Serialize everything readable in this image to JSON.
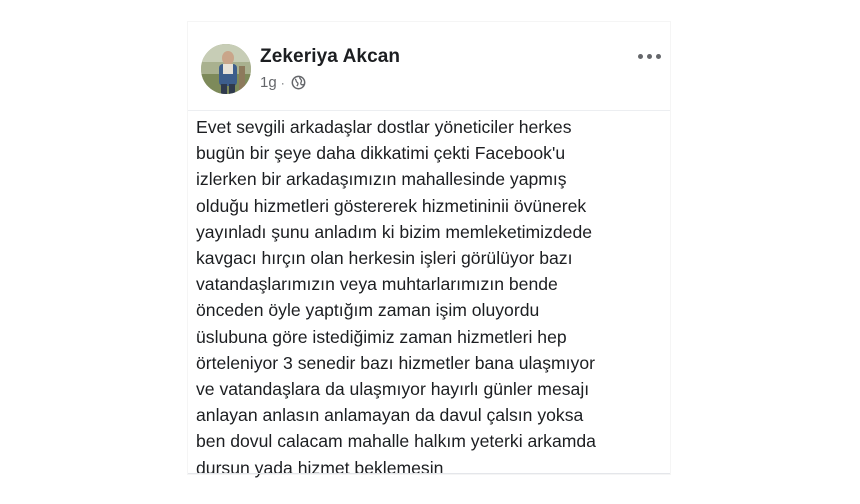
{
  "post": {
    "author": "Zekeriya Akcan",
    "time": "1g",
    "separator": "·",
    "privacy_icon": "globe-icon",
    "more_icon": "more-options-icon",
    "text": "Evet sevgili arkadaşlar dostlar yöneticiler herkes\nbugün bir şeye daha dikkatimi çekti Facebook'u\nizlerken bir arkadaşımızın mahallesinde yapmış\nolduğu hizmetleri göstererek hizmetininii övünerek\nyayınladı şunu anladım ki bizim memleketimizdede\nkavgacı hırçın olan herkesin işleri görülüyor bazı\nvatandaşlarımızın veya muhtarlarımızın bende\nönceden öyle yaptığım zaman işim oluyordu\nüslubuna göre istediğimiz zaman hizmetleri hep\nörteleniyor 3 senedir bazı hizmetler bana ulaşmıyor\nve vatandaşlara da ulaşmıyor hayırlı günler mesajı\nanlayan anlasın anlamayan da davul çalsın yoksa\nben dovul calacam mahalle halkım yeterki arkamda\ndursun yada hizmet beklemesin"
  },
  "colors": {
    "name": "#1c1e21",
    "secondary": "#65676b",
    "divider": "#e4e6ea"
  }
}
